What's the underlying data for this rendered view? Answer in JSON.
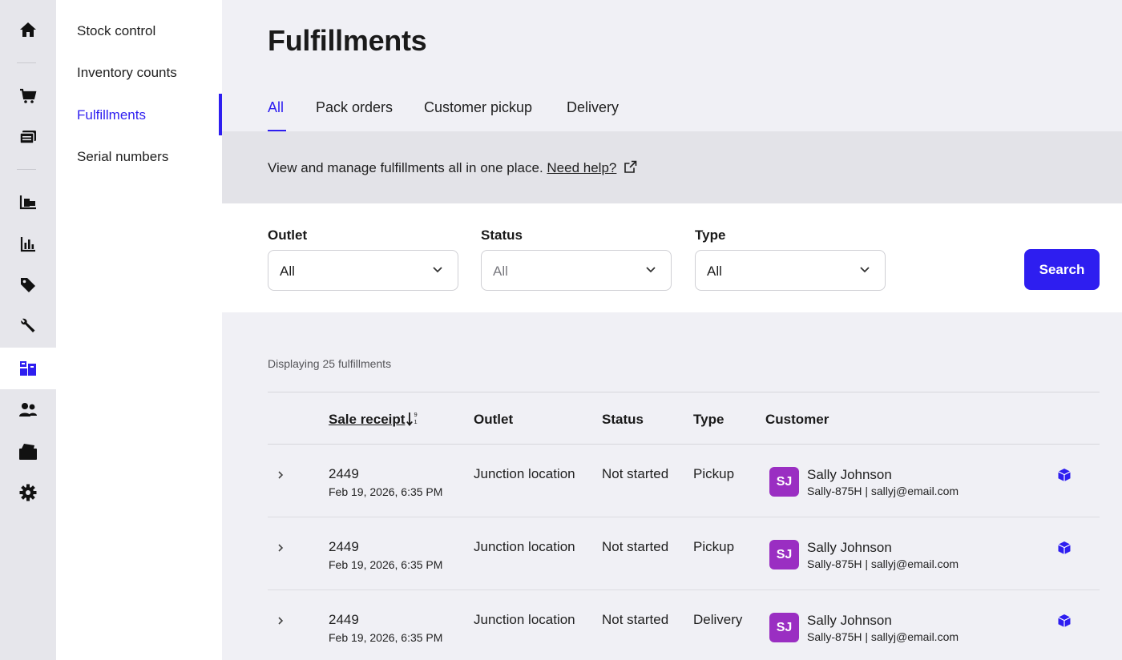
{
  "rail": {
    "items": [
      {
        "name": "home-icon"
      },
      {
        "name": "cart-icon"
      },
      {
        "name": "catalog-icon"
      },
      {
        "name": "inventory-icon"
      },
      {
        "name": "reports-icon"
      },
      {
        "name": "tag-icon"
      },
      {
        "name": "wrench-icon"
      },
      {
        "name": "fulfillment-icon",
        "active": true
      },
      {
        "name": "customers-icon"
      },
      {
        "name": "register-icon"
      },
      {
        "name": "settings-icon"
      }
    ]
  },
  "subnav": {
    "items": [
      {
        "label": "Stock control"
      },
      {
        "label": "Inventory counts"
      },
      {
        "label": "Fulfillments",
        "active": true
      },
      {
        "label": "Serial numbers"
      }
    ]
  },
  "page": {
    "title": "Fulfillments",
    "tabs": [
      {
        "label": "All",
        "active": true
      },
      {
        "label": "Pack orders"
      },
      {
        "label": "Customer pickup"
      },
      {
        "label": "Delivery"
      }
    ],
    "banner": {
      "text": "View and manage fulfillments all in one place. ",
      "link": "Need help?"
    }
  },
  "filters": {
    "outlet": {
      "label": "Outlet",
      "value": "All"
    },
    "status": {
      "label": "Status",
      "value": "All"
    },
    "type": {
      "label": "Type",
      "value": "All"
    },
    "search_label": "Search"
  },
  "results": {
    "count_text": "Displaying 25 fulfillments",
    "columns": {
      "sale_receipt": "Sale receipt",
      "outlet": "Outlet",
      "status": "Status",
      "type": "Type",
      "customer": "Customer"
    },
    "rows": [
      {
        "receipt": "2449",
        "date": "Feb 19, 2026, 6:35 PM",
        "outlet": "Junction location",
        "status": "Not started",
        "type": "Pickup",
        "initials": "SJ",
        "customer_name": "Sally Johnson",
        "customer_detail": "Sally-875H | sallyj@email.com"
      },
      {
        "receipt": "2449",
        "date": "Feb 19, 2026, 6:35 PM",
        "outlet": "Junction location",
        "status": "Not started",
        "type": "Pickup",
        "initials": "SJ",
        "customer_name": "Sally Johnson",
        "customer_detail": "Sally-875H | sallyj@email.com"
      },
      {
        "receipt": "2449",
        "date": "Feb 19, 2026, 6:35 PM",
        "outlet": "Junction location",
        "status": "Not started",
        "type": "Delivery",
        "initials": "SJ",
        "customer_name": "Sally Johnson",
        "customer_detail": "Sally-875H | sallyj@email.com"
      }
    ]
  },
  "colors": {
    "accent": "#2e1ef0",
    "avatar": "#9a2ec2",
    "rail_bg": "#e6e6eb",
    "page_bg": "#f0f0f5"
  }
}
